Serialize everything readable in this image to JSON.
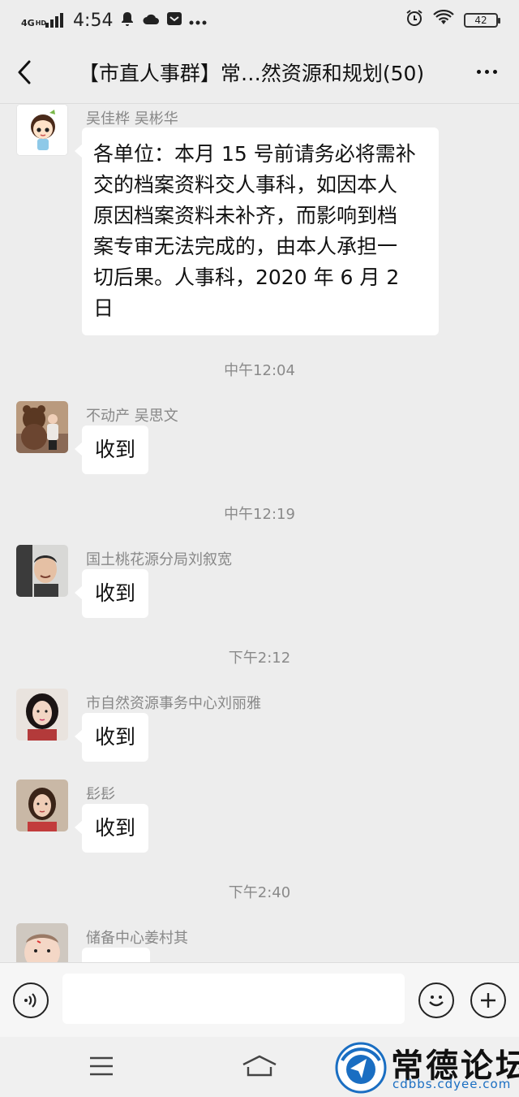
{
  "status_bar": {
    "network": "4G",
    "hd": "HD",
    "time": "4:54",
    "battery": "42"
  },
  "header": {
    "title": "【市直人事群】常…然资源和规划(50)"
  },
  "messages": [
    {
      "sender": "吴佳桦  吴彬华",
      "lines": [
        "各单位：本月 15 号前请务必将需补",
        "交的档案资料交人事科，如因本人",
        "原因档案资料未补齐，而影响到档",
        "案专审无法完成的，由本人承担一",
        "切后果。人事科，2020 年 6 月 2",
        "日"
      ]
    },
    {
      "time": "中午12:04"
    },
    {
      "sender": "不动产 吴思文",
      "text": "收到"
    },
    {
      "time": "中午12:19"
    },
    {
      "sender": "国土桃花源分局刘叙宽",
      "text": "收到"
    },
    {
      "time": "下午2:12"
    },
    {
      "sender": "市自然资源事务中心刘丽雅",
      "text": "收到"
    },
    {
      "sender": "髟髟",
      "text": "收到"
    },
    {
      "time": "下午2:40"
    },
    {
      "sender": "储备中心姜村其",
      "text": ""
    }
  ],
  "watermark": {
    "brand": "常德论坛",
    "url": "cdbbs.cdyee.com"
  }
}
